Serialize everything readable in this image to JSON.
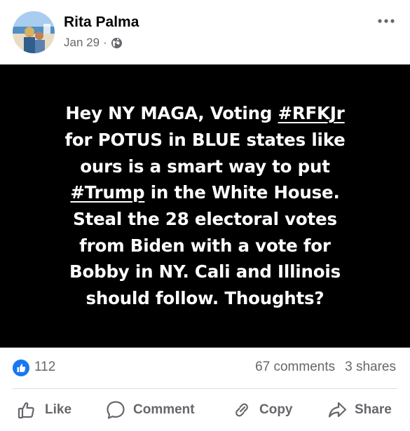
{
  "post": {
    "author": "Rita Palma",
    "date": "Jan 29",
    "separator": "·",
    "privacy_icon": "globe-icon",
    "image_text": {
      "line1_a": "Hey NY MAGA, Voting ",
      "line1_tag": "#RFKJr",
      "line2": "for POTUS in BLUE states like",
      "line3": "ours is a smart way to put",
      "line4_tag": "#Trump",
      "line4_b": " in the White House.",
      "line5": "Steal the 28 electoral votes",
      "line6": "from Biden with a vote for",
      "line7": "Bobby in NY. Cali and Illinois",
      "line8": "should follow. Thoughts?"
    }
  },
  "stats": {
    "likes": "112",
    "comments": "67 comments",
    "shares": "3 shares"
  },
  "actions": {
    "like": "Like",
    "comment": "Comment",
    "copy": "Copy",
    "share": "Share"
  },
  "colors": {
    "accent": "#1877f2",
    "secondary_text": "#65676b",
    "image_bg": "#000000"
  }
}
